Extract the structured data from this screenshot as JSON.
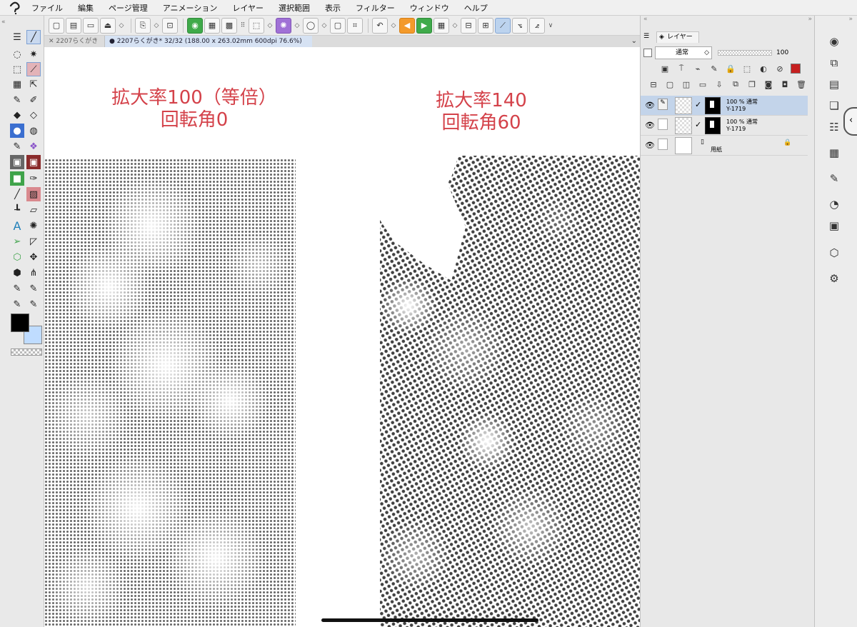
{
  "menubar": {
    "items": [
      "ファイル",
      "編集",
      "ページ管理",
      "アニメーション",
      "レイヤー",
      "選択範囲",
      "表示",
      "フィルター",
      "ウィンドウ",
      "ヘルプ"
    ]
  },
  "tabs": {
    "tab1": "2207らくがき",
    "tab2": "2207らくがき* 32/32 (188.00 x 263.02mm 600dpi 76.6%)"
  },
  "canvas": {
    "left_caption_line1": "拡大率100（等倍）",
    "left_caption_line2": "回転角0",
    "right_caption_line1": "拡大率140",
    "right_caption_line2": "回転角60",
    "caption_color": "#d4424a"
  },
  "layer_panel": {
    "tab_label": "レイヤー",
    "blend_mode": "通常",
    "opacity_value": "100",
    "color_swatch": "#c62020",
    "layers": [
      {
        "line1": "100 % 通常",
        "line2": "Y-1719"
      },
      {
        "line1": "100 % 通常",
        "line2": "Y-1719"
      },
      {
        "name": "用紙"
      }
    ]
  },
  "colors": {
    "main": "#000000",
    "sub": "#bfdcff",
    "selection": "#c3d4ea"
  }
}
